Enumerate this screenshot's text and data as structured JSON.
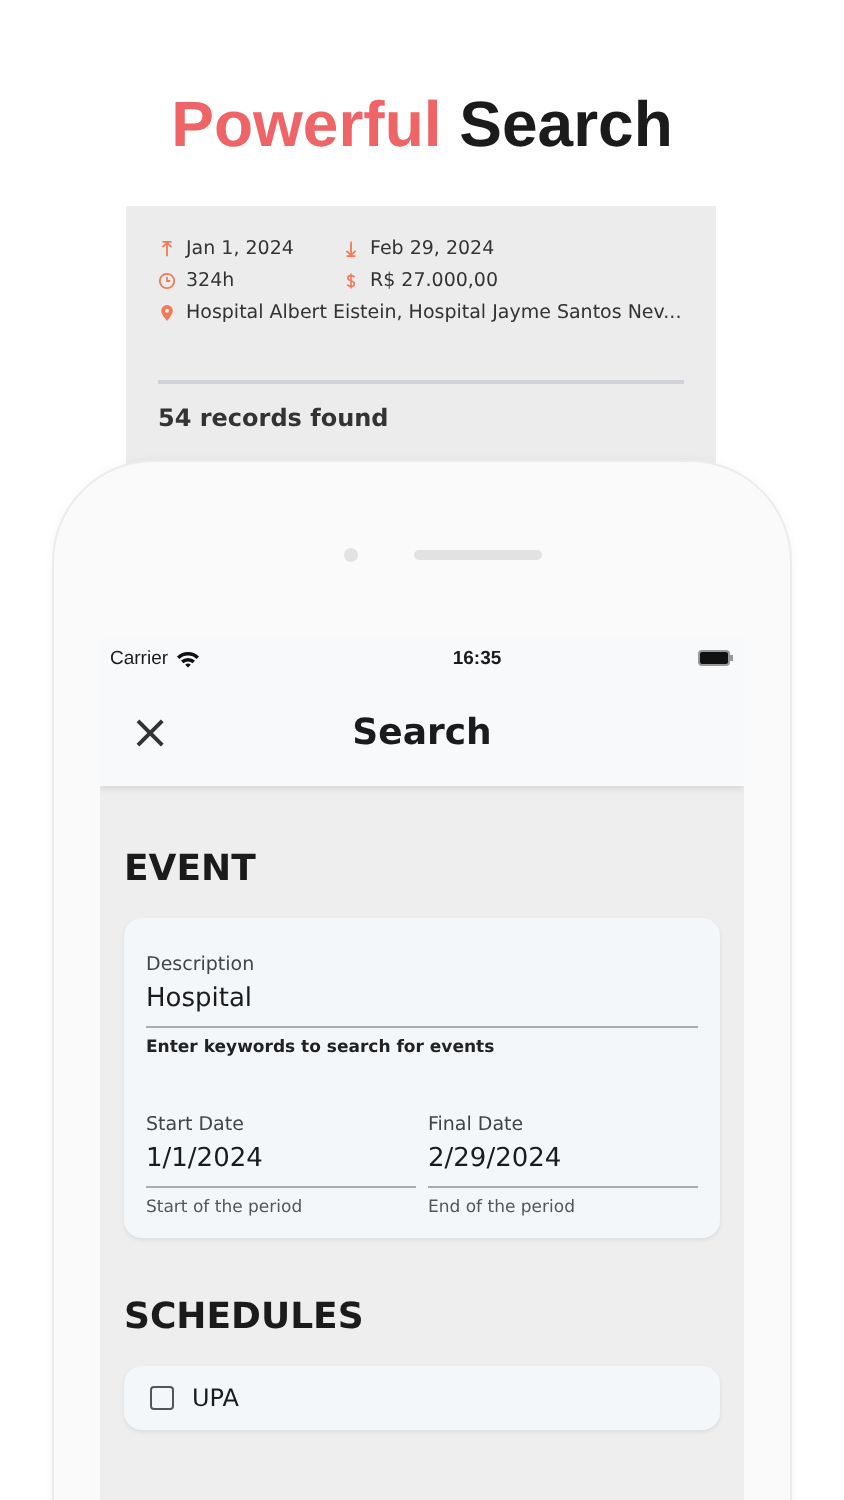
{
  "headline": {
    "accent": "Powerful",
    "rest": "Search"
  },
  "results_preview": {
    "start_date": "Jan 1, 2024",
    "end_date": "Feb 29, 2024",
    "hours": "324h",
    "amount": "R$ 27.000,00",
    "locations": "Hospital Albert Eistein, Hospital Jayme Santos Nev...",
    "count": "54 records found"
  },
  "status_bar": {
    "carrier": "Carrier",
    "time": "16:35"
  },
  "nav": {
    "close": "×",
    "title": "Search"
  },
  "event": {
    "heading": "EVENT",
    "description": {
      "label": "Description",
      "value": "Hospital",
      "helper": "Enter keywords to search for events"
    },
    "dates": [
      {
        "label": "Start Date",
        "value": "1/1/2024",
        "helper": "Start of the period"
      },
      {
        "label": "Final Date",
        "value": "2/29/2024",
        "helper": "End of the period"
      }
    ]
  },
  "schedules": {
    "heading": "SCHEDULES",
    "items": [
      {
        "label": "UPA",
        "checked": false
      }
    ]
  }
}
